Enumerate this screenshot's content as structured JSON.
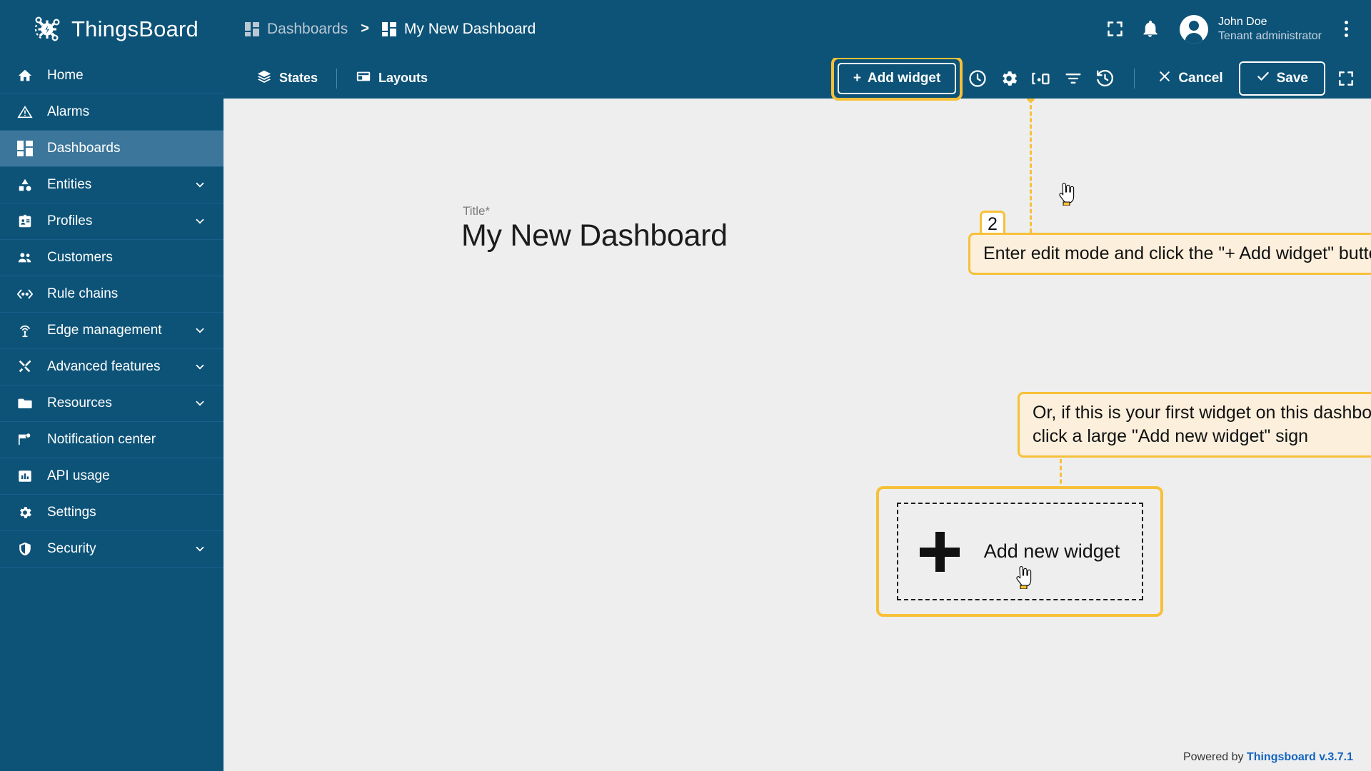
{
  "brand": {
    "name": "ThingsBoard",
    "logo_icon": "thingsboard-bug-logo"
  },
  "header": {
    "breadcrumb": [
      {
        "label": "Dashboards",
        "icon": "dashboard-grid-icon"
      },
      {
        "label": "My New Dashboard",
        "icon": "dashboard-grid-icon"
      }
    ],
    "separator": ">",
    "fullscreen_icon": "fullscreen-icon",
    "notifications_icon": "bell-icon",
    "avatar_icon": "user-avatar-icon",
    "user_name": "John Doe",
    "user_role": "Tenant administrator",
    "more_icon": "kebab-menu-icon"
  },
  "sidebar": {
    "items": [
      {
        "label": "Home",
        "icon": "home-icon",
        "active": false,
        "expandable": false
      },
      {
        "label": "Alarms",
        "icon": "alarm-warning-icon",
        "active": false,
        "expandable": false
      },
      {
        "label": "Dashboards",
        "icon": "dashboard-grid-icon",
        "active": true,
        "expandable": false
      },
      {
        "label": "Entities",
        "icon": "entities-icon",
        "active": false,
        "expandable": true
      },
      {
        "label": "Profiles",
        "icon": "profiles-badge-icon",
        "active": false,
        "expandable": true
      },
      {
        "label": "Customers",
        "icon": "customers-people-icon",
        "active": false,
        "expandable": false
      },
      {
        "label": "Rule chains",
        "icon": "rule-chains-icon",
        "active": false,
        "expandable": false
      },
      {
        "label": "Edge management",
        "icon": "edge-antenna-icon",
        "active": false,
        "expandable": true
      },
      {
        "label": "Advanced features",
        "icon": "tools-icon",
        "active": false,
        "expandable": true
      },
      {
        "label": "Resources",
        "icon": "folder-icon",
        "active": false,
        "expandable": true
      },
      {
        "label": "Notification center",
        "icon": "notification-flag-icon",
        "active": false,
        "expandable": false
      },
      {
        "label": "API usage",
        "icon": "api-usage-chart-icon",
        "active": false,
        "expandable": false
      },
      {
        "label": "Settings",
        "icon": "gear-icon",
        "active": false,
        "expandable": false
      },
      {
        "label": "Security",
        "icon": "shield-icon",
        "active": false,
        "expandable": true
      }
    ]
  },
  "toolbar": {
    "states_label": "States",
    "states_icon": "layers-icon",
    "layouts_label": "Layouts",
    "layouts_icon": "layout-icon",
    "add_widget_label": "Add widget",
    "add_widget_plus": "+",
    "timewindow_icon": "clock-icon",
    "settings_icon": "gear-icon",
    "devices_icon": "devices-icon",
    "filters_icon": "filter-icon",
    "versions_icon": "history-restore-icon",
    "cancel_label": "Cancel",
    "cancel_icon": "close-x-icon",
    "save_label": "Save",
    "save_icon": "check-icon",
    "fullscreen_icon": "fullscreen-icon"
  },
  "dashboard": {
    "title_label": "Title*",
    "title_value": "My New Dashboard"
  },
  "callouts": [
    {
      "step": "2",
      "text": "Enter edit mode and click the \"+ Add widget\" button"
    },
    {
      "step": "",
      "text": "Or, if this is your first widget on this dashboard,\nclick a large \"Add new widget\" sign"
    }
  ],
  "widget_placeholder": {
    "label": "Add new widget",
    "plus_icon": "plus-icon"
  },
  "footer": {
    "prefix": "Powered by ",
    "link": "Thingsboard v.3.7.1"
  },
  "colors": {
    "brand_blue": "#0d5378",
    "sidebar_active": "#3c779b",
    "highlight_yellow": "#f7c038",
    "callout_bg": "#fcefdc",
    "canvas_bg": "#eeeeee",
    "link_blue": "#1565c0"
  }
}
